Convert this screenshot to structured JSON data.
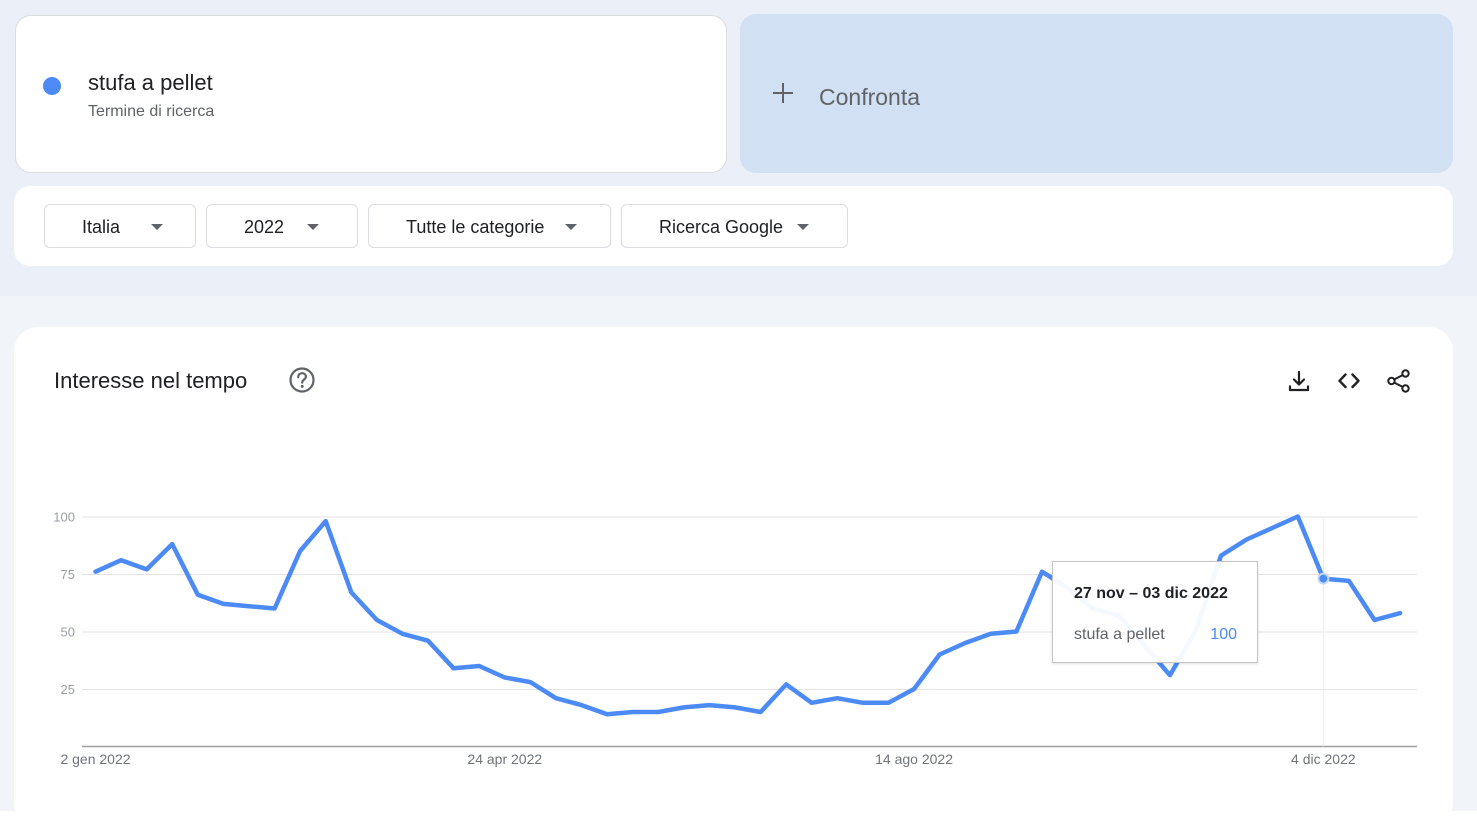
{
  "term": {
    "name": "stufa a pellet",
    "subtitle": "Termine di ricerca",
    "color": "#4c8bf5"
  },
  "compare": {
    "icon": "plus-icon",
    "label": "Confronta"
  },
  "filters": [
    {
      "label": "Italia",
      "icon": "caret-down-icon"
    },
    {
      "label": "2022",
      "icon": "caret-down-icon"
    },
    {
      "label": "Tutte le categorie",
      "icon": "caret-down-icon"
    },
    {
      "label": "Ricerca Google",
      "icon": "caret-down-icon"
    }
  ],
  "panel": {
    "title": "Interesse nel tempo",
    "icons": [
      "help-icon",
      "download-icon",
      "embed-code-icon",
      "share-icon"
    ]
  },
  "tooltip": {
    "date": "27 nov – 03 dic 2022",
    "series": "stufa a pellet",
    "value": "100"
  },
  "chart_data": {
    "type": "line",
    "x_labels": [
      "2 gen 2022",
      "24 apr 2022",
      "14 ago 2022",
      "4 dic 2022"
    ],
    "x_label_week_index": [
      0,
      16,
      32,
      48
    ],
    "yticks": [
      25,
      50,
      75,
      100
    ],
    "ylim": [
      0,
      100
    ],
    "grid": true,
    "highlight_week_index": 48,
    "series": [
      {
        "name": "stufa a pellet",
        "color": "#4c8bf5",
        "values": [
          76,
          81,
          77,
          88,
          66,
          62,
          61,
          60,
          85,
          98,
          67,
          55,
          49,
          46,
          34,
          35,
          30,
          28,
          21,
          18,
          14,
          15,
          15,
          17,
          18,
          17,
          15,
          27,
          19,
          21,
          19,
          19,
          25,
          40,
          45,
          49,
          50,
          76,
          69,
          60,
          57,
          44,
          31,
          50,
          83,
          90,
          95,
          100,
          73,
          72,
          55,
          58
        ]
      }
    ]
  }
}
